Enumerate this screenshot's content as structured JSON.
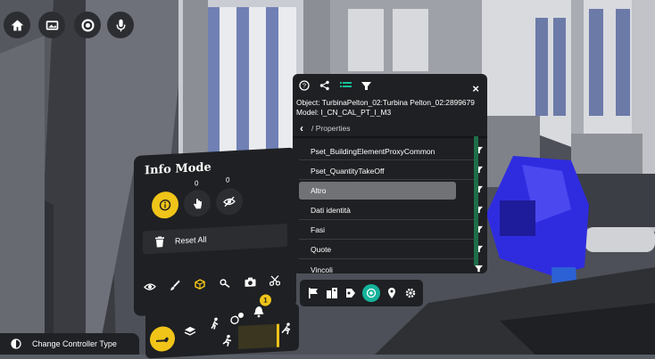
{
  "top_toolbar": {
    "icons": [
      "home-icon",
      "image-icon",
      "app-logo-icon",
      "microphone-icon"
    ]
  },
  "properties_panel": {
    "header_icons": [
      "help-icon",
      "share-icon",
      "list-icon",
      "filter-icon"
    ],
    "close_label": "×",
    "object_line": "Object: TurbinaPelton_02:Turbina Pelton_02:2899679",
    "model_line": "Model: I_CN_CAL_PT_I_M3",
    "back_label": "‹",
    "breadcrumb": "/ Properties",
    "rows": [
      {
        "label": "Pset_BuildingElementProxyCommon"
      },
      {
        "label": "Pset_QuantityTakeOff"
      },
      {
        "label": "Altro"
      },
      {
        "label": "Dati identità"
      },
      {
        "label": "Fasi"
      },
      {
        "label": "Quote"
      },
      {
        "label": "Vincoli"
      }
    ],
    "selected_row": 2
  },
  "properties_toolbar": {
    "icons": [
      "flag-icon",
      "building-icon",
      "tag-icon",
      "layers-active-icon",
      "pin-icon",
      "gear-icon"
    ]
  },
  "info_panel": {
    "title": "Info Mode",
    "counter_hand": "0",
    "counter_hidden": "0",
    "reset_label": "Reset All",
    "tools": [
      "eye-icon",
      "brush-icon",
      "cube-icon",
      "key-icon",
      "camera-icon",
      "scissors-icon"
    ]
  },
  "bottom_toolbar": {
    "badge_count": "1"
  },
  "controller": {
    "label": "Change Controller Type"
  },
  "colors": {
    "accent_yellow": "#f0c419",
    "accent_teal": "#14b39a",
    "panel_bg": "#1f2023",
    "scroll_green": "#1d6e48",
    "selected_row": "#707276"
  }
}
